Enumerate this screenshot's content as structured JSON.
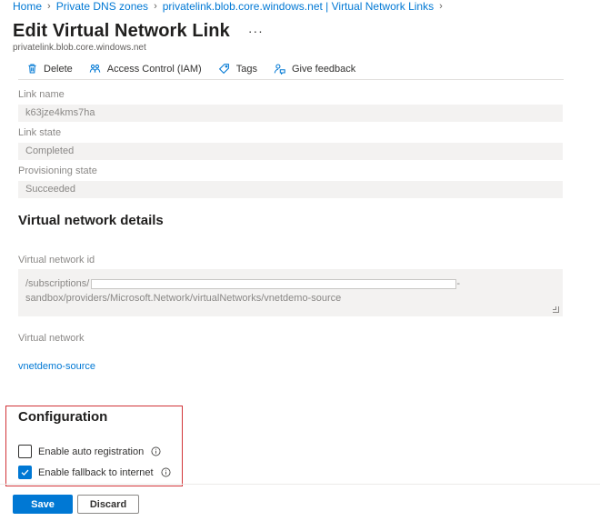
{
  "breadcrumb": {
    "items": [
      "Home",
      "Private DNS zones",
      "privatelink.blob.core.windows.net | Virtual Network Links"
    ]
  },
  "header": {
    "title": "Edit Virtual Network Link",
    "more": "···",
    "subtitle": "privatelink.blob.core.windows.net"
  },
  "toolbar": {
    "delete_label": "Delete",
    "iam_label": "Access Control (IAM)",
    "tags_label": "Tags",
    "feedback_label": "Give feedback"
  },
  "fields": {
    "link_name_label": "Link name",
    "link_name_value": "k63jze4kms7ha",
    "link_state_label": "Link state",
    "link_state_value": "Completed",
    "provisioning_label": "Provisioning state",
    "provisioning_value": "Succeeded"
  },
  "vnet_details": {
    "title": "Virtual network details",
    "id_label": "Virtual network id",
    "id_prefix": "/subscriptions/",
    "id_suffix_line1": "-",
    "id_line2": "sandbox/providers/Microsoft.Network/virtualNetworks/vnetdemo-source",
    "vnet_label": "Virtual network",
    "vnet_value": "vnetdemo-source"
  },
  "configuration": {
    "title": "Configuration",
    "auto_registration_label": "Enable auto registration",
    "auto_registration_checked": false,
    "fallback_label": "Enable fallback to internet",
    "fallback_checked": true
  },
  "footer": {
    "save_label": "Save",
    "discard_label": "Discard"
  },
  "colors": {
    "accent": "#0078d4",
    "highlight_border": "#d13438"
  }
}
